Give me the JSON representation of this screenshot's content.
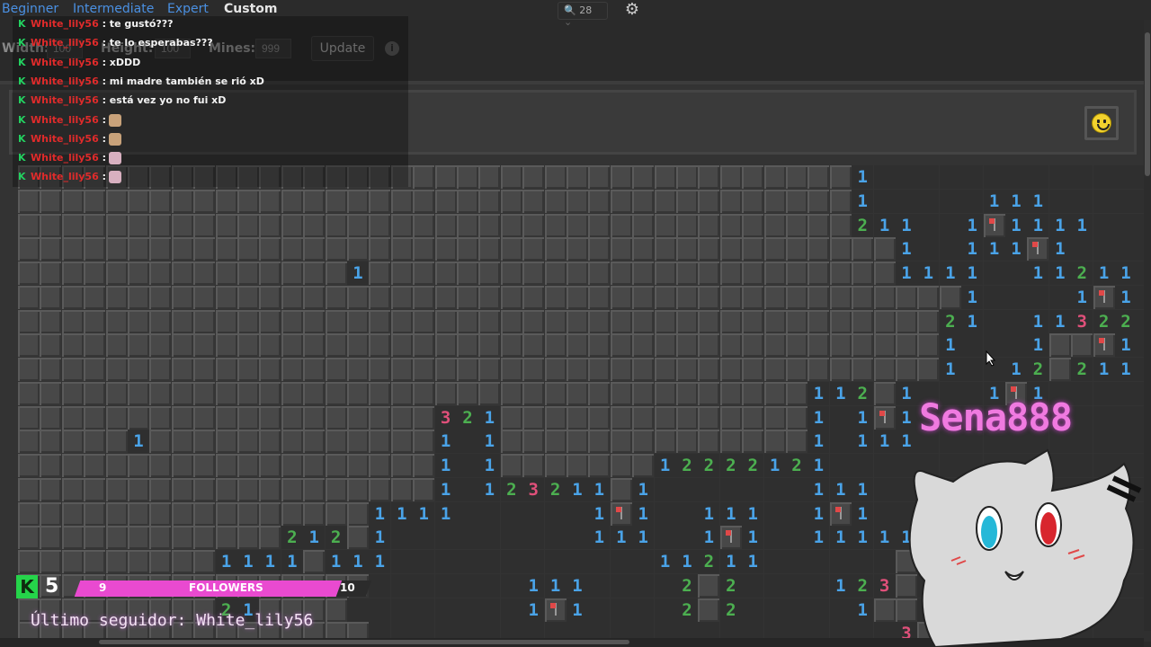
{
  "top_menu": {
    "modes": [
      {
        "label": "Beginner",
        "active": false
      },
      {
        "label": "Intermediate",
        "active": false
      },
      {
        "label": "Expert",
        "active": false
      },
      {
        "label": "Custom",
        "active": true
      }
    ],
    "zoom_value": "28",
    "zoom_icon": "search-icon",
    "settings_icon": "gear-icon"
  },
  "custom_settings": {
    "width_label": "Width:",
    "width_value": "100",
    "height_label": "Height:",
    "height_value": "100",
    "mines_label": "Mines:",
    "mines_value": "999",
    "update_label": "Update",
    "info_icon": "i"
  },
  "chat": [
    {
      "user": "White_lily56",
      "text": ": te gustó???"
    },
    {
      "user": "White_lily56",
      "text": ": te lo esperabas???"
    },
    {
      "user": "White_lily56",
      "text": ": xDDD"
    },
    {
      "user": "White_lily56",
      "text": ": mi madre también se rió xD"
    },
    {
      "user": "White_lily56",
      "text": ": está vez yo no fui xD"
    },
    {
      "user": "White_lily56",
      "text": ":",
      "emote": "#c8a27a"
    },
    {
      "user": "White_lily56",
      "text": ":",
      "emote": "#c8a27a"
    },
    {
      "user": "White_lily56",
      "text": ":",
      "emote": "#d8b0c0"
    },
    {
      "user": "White_lily56",
      "text": ":",
      "emote": "#d8b0c0"
    }
  ],
  "followers": {
    "kick_logo": "K",
    "count": "5",
    "goal_current": "9",
    "goal_label": "FOLLOWERS",
    "goal_max": "10",
    "progress": 0.9,
    "last_follower": "Último seguidor: White_lily56"
  },
  "streamer": {
    "name": "Sena888"
  },
  "colors": {
    "n1": "#4aa3e8",
    "n2": "#4caf50",
    "n3": "#e0507a",
    "accent_pink": "#e94ad0",
    "kick_green": "#25d44a"
  },
  "board": {
    "cell_legend": {
      "C": "closed",
      "O": "open-empty",
      "F": "flag"
    },
    "rows": [
      "CCCCCCCCCCCCCCCCCCCCCCCCCCCCCCCCCCCCCC1OOOOOOOOOOOOOOOOOOOOOO",
      "CCCCCCCCCCCCCCCCCCCCCCCCCCCCCCCCCCCCCC1OOOOO111OOOOOOOOOOOOOO",
      "CCCCCCCCCCCCCCCCCCCCCCCCCCCCCCCCCCCCCC211OO1F1111OOOOOOOOOOOO",
      "CCCCCCCCCCCCCCCCCCCCCCCCCCCCCCCCCCCCCCCC1OO111F1OOOOOOOOOOOO",
      "CCCCCCCCCCCCCCC1CCCCCCCCCCCCCCCCCCCCCCCC1111OO11211OOOOOOOOOO",
      "CCCCCCCCCCCCCCCCCCCCCCCCCCCCCCCCCCCCCCCCCCC1OOOO1F1OOOO1OOOOO",
      "CCCCCCCCCCCCCCCCCCCCCCCCCCCCCCCCCCCCCCCCCC21OO11322OOOO1OOOOO",
      "CCCCCCCCCCCCCCCCCCCCCCCCCCCCCCCCCCCCCCCCCC1OOO1CCF1OOOO1OOOOO",
      "CCCCCCCCCCCCCCCCCCCCCCCCCCCCCCCCCCCCCCCCCC1OO12C211OOOO1OOOOO",
      "CCCCCCCCCCCCCCCCCCCCCCCCCCCCCCCCCCCC112C1OOO1F1OOOO111OOOOOOO",
      "CCCCCCCCCCCCCCCCCCC321CCCCCCCCCCCCCC1O1F1OOOOOOOOOOOOOOOOOOOO",
      "CCCCC1CCCCCCCCCCCCC1O1CCCCCCCCCCCCCC1O111OOOOOOOOOOOOOOOOOOOO",
      "CCCCCCCCCCCCCCCCCCC1O1CCCCCCC12222121OOOOOOOOOOOOOOOOOOOOOOOO",
      "CCCCCCCCCCCCCCCCCCC1O123211C1OOOOOOO111OOOOOOOOOOOOOOOOOOOOOO",
      "CCCCCCCCCCCCCCCC1111OOOOOO1F1OO111OO1F1OOOOOOOOOOOOOOOOOOOOOO",
      "CCCCCCCCCCCC212C1OOOOOOOOO111OO1F1OO111111OOOOOOOOOOOOOOOOOOO",
      "CCCCCCCCC1111C111OOOOOOOOOOOO11211OOOOOOCCC1OOOOOOOOOOOOOOOOO",
      "CCCCCCCCCCCCCCCCOOOOOOO111OOOO2C2OOOO123C21OOOOOOOOOOOOOOOOOO",
      "CCCCCCCCC21CCCCOOOOOOOO1F1OOOO2C2OOOOO1CC21OOOOOOOOOOOOOOOOOO",
      "CCCCCCCCCCCCCCCCOOOOOOOOOOOOOOOOOOOOOOOO3C2OOOOOOOOOOOOOOOOOO"
    ]
  }
}
